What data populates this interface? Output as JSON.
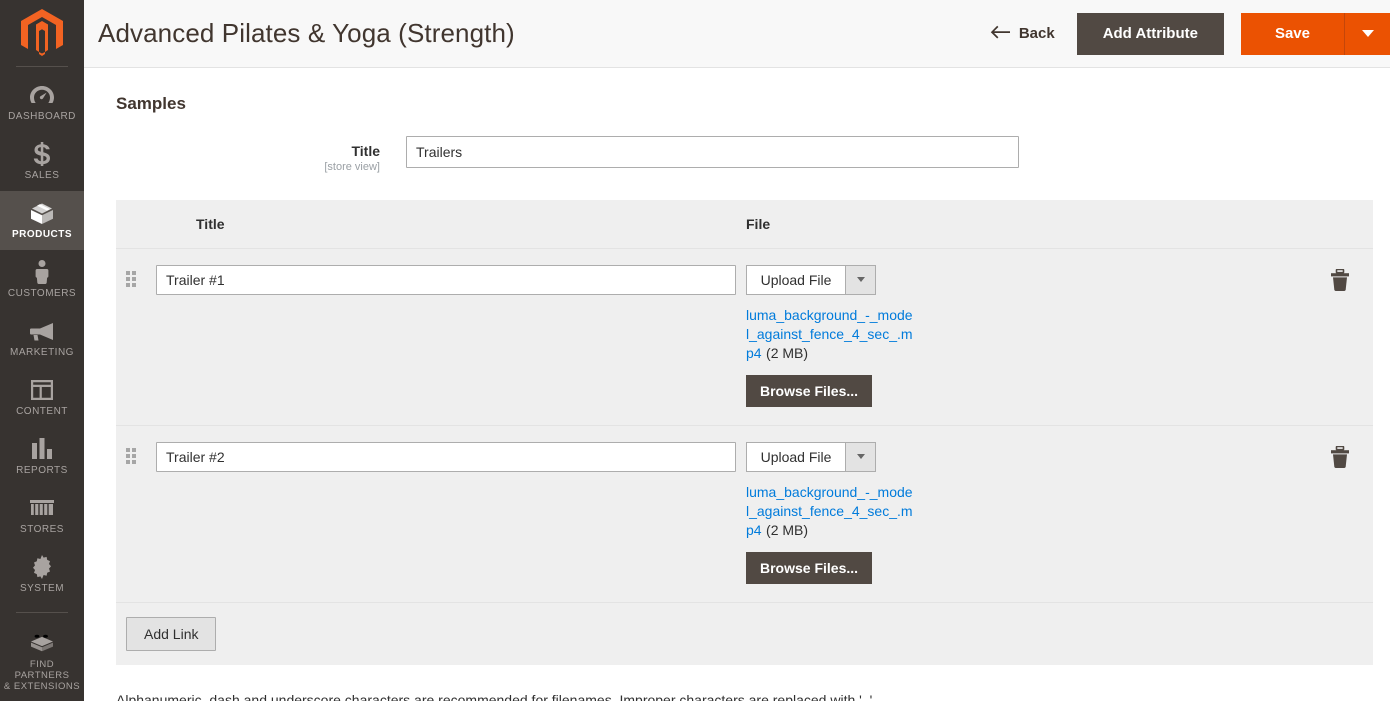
{
  "sidebar": {
    "logo_name": "magento-logo",
    "logo_color": "#f26322",
    "items": [
      {
        "label": "Dashboard",
        "icon": "dashboard-gauge-icon",
        "active": false
      },
      {
        "label": "Sales",
        "icon": "dollar-sign-icon",
        "active": false
      },
      {
        "label": "Products",
        "icon": "box-package-icon",
        "active": true
      },
      {
        "label": "Customers",
        "icon": "person-icon",
        "active": false
      },
      {
        "label": "Marketing",
        "icon": "megaphone-icon",
        "active": false
      },
      {
        "label": "Content",
        "icon": "layout-panel-icon",
        "active": false
      },
      {
        "label": "Reports",
        "icon": "bar-chart-icon",
        "active": false
      },
      {
        "label": "Stores",
        "icon": "storefront-icon",
        "active": false
      },
      {
        "label": "System",
        "icon": "gear-icon",
        "active": false
      }
    ],
    "footer_item": {
      "label": "Find Partners\n& Extensions",
      "label_line1": "Find Partners",
      "label_line2": "& Extensions",
      "icon": "lego-brick-icon"
    }
  },
  "header": {
    "title": "Advanced Pilates & Yoga (Strength)",
    "back_label": "Back",
    "back_icon": "arrow-left-icon",
    "add_attribute_label": "Add Attribute",
    "save_label": "Save",
    "save_toggle_icon": "caret-down-icon",
    "save_color": "#eb5202",
    "add_attribute_color": "#514943"
  },
  "content": {
    "section_title": "Samples",
    "title_field": {
      "label": "Title",
      "scope": "[store view]",
      "value": "Trailers",
      "placeholder": ""
    },
    "table": {
      "columns": {
        "title": "Title",
        "file": "File"
      },
      "rows": [
        {
          "handle_icon": "drag-handle-icon",
          "title_value": "Trailer #1",
          "title_placeholder": "",
          "upload_label": "Upload File",
          "upload_toggle_icon": "caret-down-icon",
          "file_name": "luma_background_-_model_against_fence_4_sec_.mp4",
          "file_size": "(2 MB)",
          "browse_label": "Browse Files...",
          "delete_icon": "trash-icon"
        },
        {
          "handle_icon": "drag-handle-icon",
          "title_value": "Trailer #2",
          "title_placeholder": "",
          "upload_label": "Upload File",
          "upload_toggle_icon": "caret-down-icon",
          "file_name": "luma_background_-_model_against_fence_4_sec_.mp4",
          "file_size": "(2 MB)",
          "browse_label": "Browse Files...",
          "delete_icon": "trash-icon"
        }
      ],
      "add_link_label": "Add Link"
    },
    "footer_note": "Alphanumeric, dash and underscore characters are recommended for filenames. Improper characters are replaced with '_'."
  },
  "colors": {
    "sidebar_bg": "#373330",
    "sidebar_active_bg": "#55504c",
    "accent_orange": "#eb5202",
    "link_blue": "#007bdb",
    "table_bg": "#efefef"
  }
}
